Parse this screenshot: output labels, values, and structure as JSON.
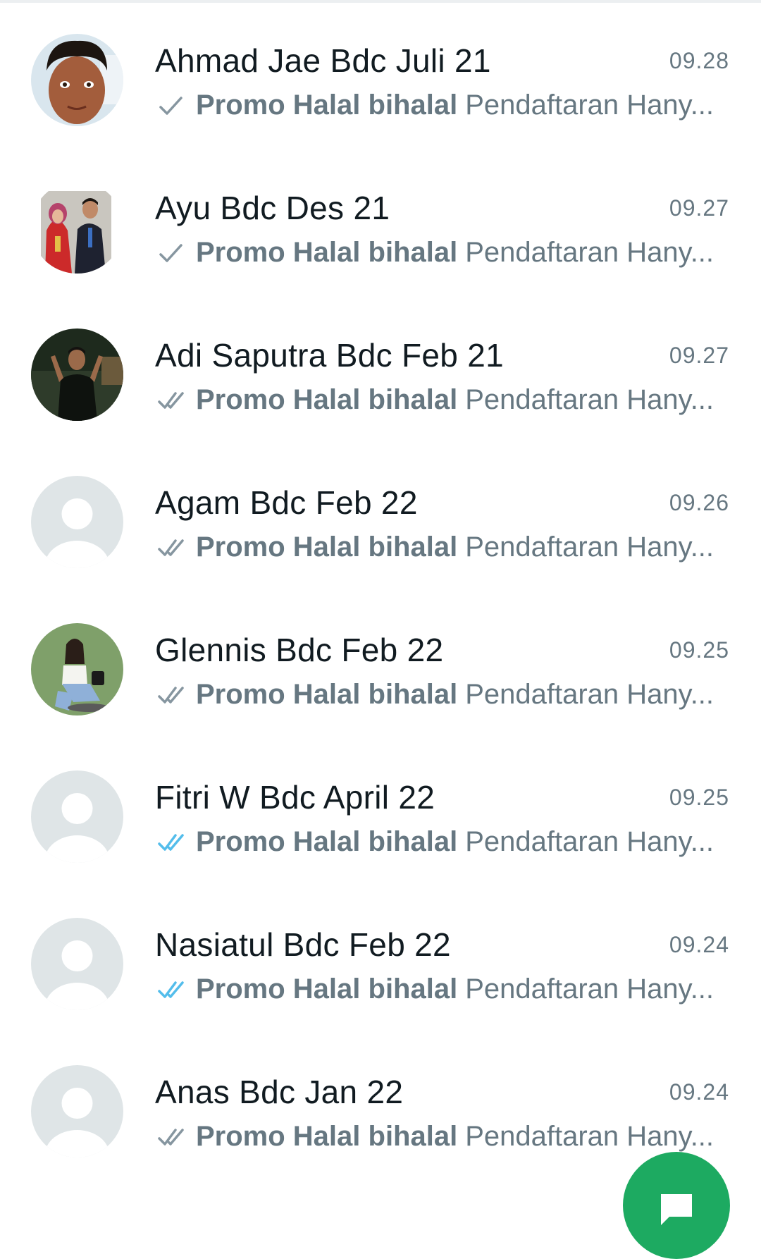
{
  "chats": [
    {
      "name": "Ahmad Jae Bdc Juli 21",
      "time": "09.28",
      "bold": "Promo Halal bihalal",
      "text": "Pendaftaran Hany...",
      "status": "sent",
      "avatar": "photo-boy"
    },
    {
      "name": "Ayu Bdc Des 21",
      "time": "09.27",
      "bold": "Promo Halal bihalal",
      "text": "Pendaftaran Hany...",
      "status": "sent",
      "avatar": "photo-couple"
    },
    {
      "name": "Adi Saputra Bdc Feb 21",
      "time": "09.27",
      "bold": "Promo Halal bihalal",
      "text": "Pendaftaran Hany...",
      "status": "delivered",
      "avatar": "photo-man"
    },
    {
      "name": "Agam Bdc Feb 22",
      "time": "09.26",
      "bold": "Promo Halal bihalal",
      "text": "Pendaftaran Hany...",
      "status": "delivered",
      "avatar": "default"
    },
    {
      "name": "Glennis Bdc Feb 22",
      "time": "09.25",
      "bold": "Promo Halal bihalal",
      "text": "Pendaftaran Hany...",
      "status": "delivered",
      "avatar": "photo-girl"
    },
    {
      "name": "Fitri W Bdc April 22",
      "time": "09.25",
      "bold": "Promo Halal bihalal",
      "text": "Pendaftaran Hany...",
      "status": "read",
      "avatar": "default"
    },
    {
      "name": "Nasiatul Bdc Feb 22",
      "time": "09.24",
      "bold": "Promo Halal bihalal",
      "text": "Pendaftaran Hany...",
      "status": "read",
      "avatar": "default"
    },
    {
      "name": "Anas Bdc Jan 22",
      "time": "09.24",
      "bold": "Promo Halal bihalal",
      "text": "Pendaftaran Hany...",
      "status": "delivered",
      "avatar": "default"
    }
  ],
  "colors": {
    "name": "#111b21",
    "secondary": "#667781",
    "tick_gray": "#8696a0",
    "tick_blue": "#53bdeb",
    "fab": "#1daa61",
    "default_avatar_bg": "#dfe5e7"
  },
  "fab": {
    "icon": "new-chat-icon"
  }
}
